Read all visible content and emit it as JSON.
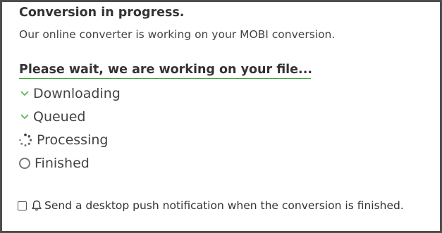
{
  "heading": "Conversion in progress.",
  "subheading": "Our online converter is working on your MOBI conversion.",
  "wait_title": "Please wait, we are working on your file...",
  "steps": [
    {
      "label": "Downloading",
      "state": "done",
      "icon": "chevron-down-icon"
    },
    {
      "label": "Queued",
      "state": "done",
      "icon": "chevron-down-icon"
    },
    {
      "label": "Processing",
      "state": "active",
      "icon": "spinner-icon"
    },
    {
      "label": "Finished",
      "state": "pending",
      "icon": "empty-circle-icon"
    }
  ],
  "notification": {
    "label": "Send a desktop push notification when the conversion is finished.",
    "checked": false,
    "icon": "bell-icon"
  },
  "colors": {
    "accent_green": "#3aaa35",
    "check_green": "#5cb85c",
    "border": "#4d4d4d"
  }
}
